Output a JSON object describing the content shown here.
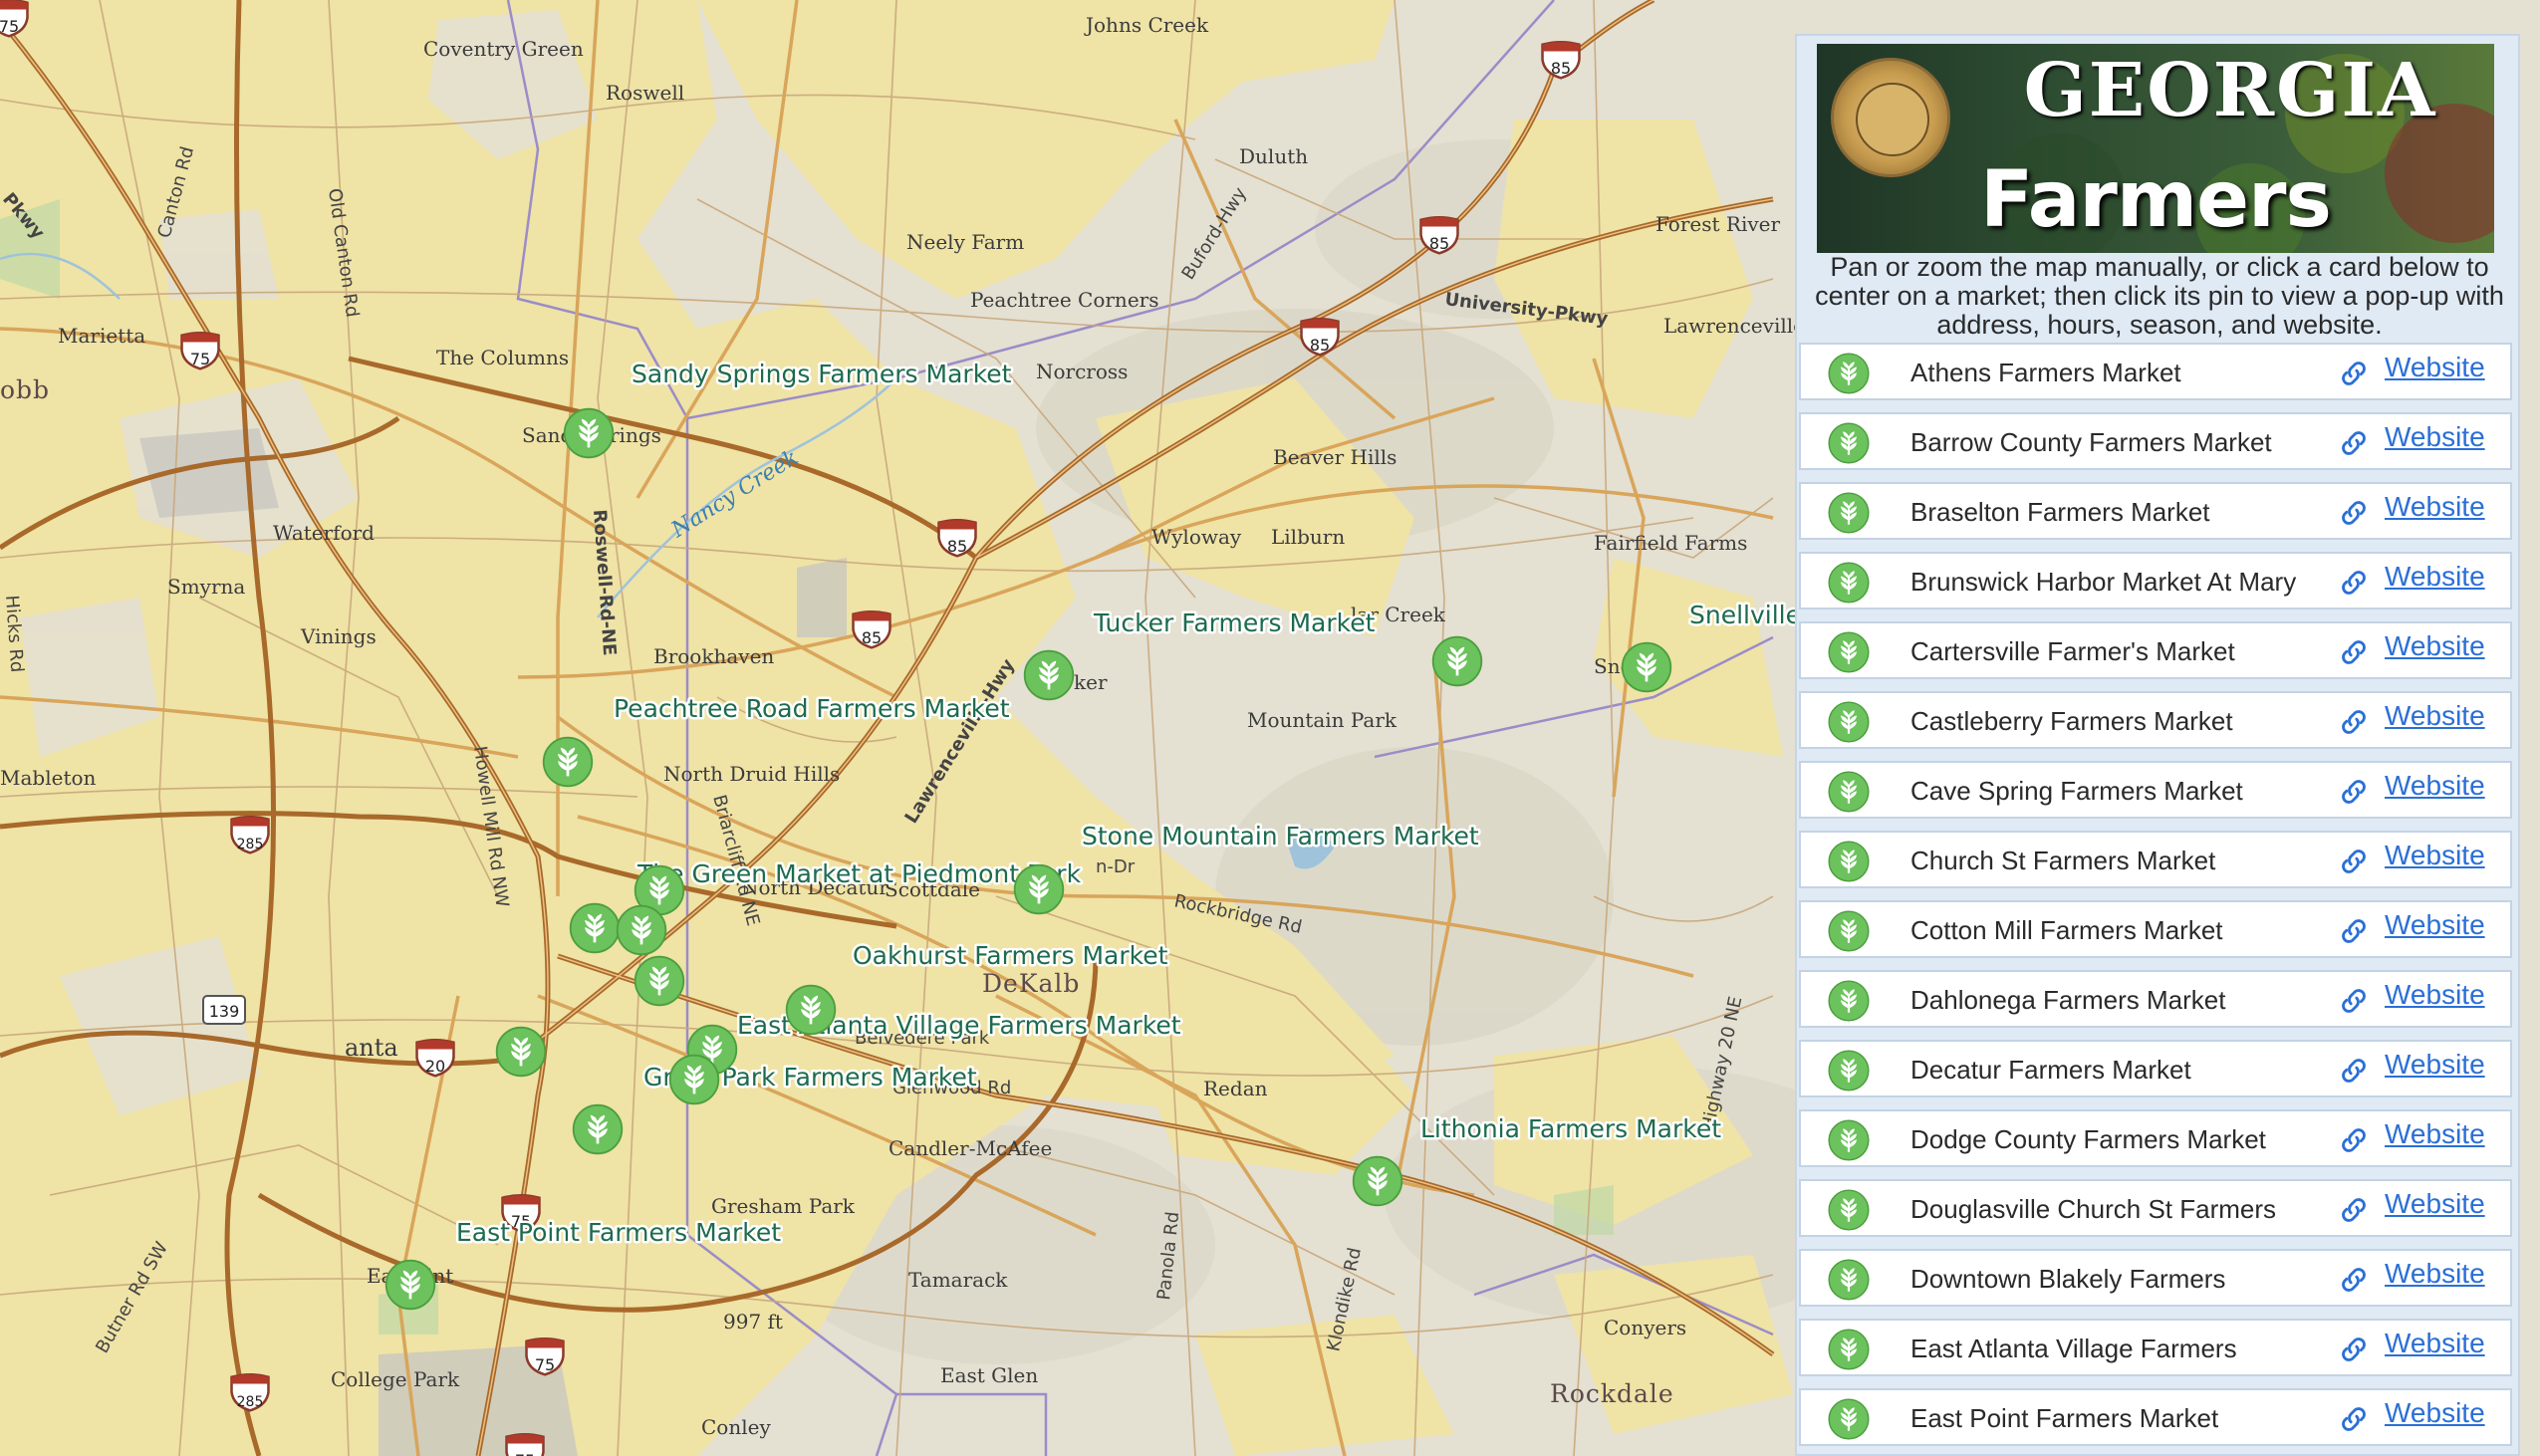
{
  "map": {
    "water_color": "#9ec3db",
    "urban_color": "#efe3a6",
    "terrain_color": "#e4e0d2",
    "highway_color": "#b07a3a",
    "pin_color": "#6cc25c",
    "place_labels": [
      {
        "id": "coventry-green",
        "text": "Coventry Green"
      },
      {
        "id": "johns-creek",
        "text": "Johns Creek"
      },
      {
        "id": "roswell",
        "text": "Roswell"
      },
      {
        "id": "duluth",
        "text": "Duluth"
      },
      {
        "id": "marietta",
        "text": "Marietta"
      },
      {
        "id": "neely-farm",
        "text": "Neely Farm"
      },
      {
        "id": "peachtree-corners",
        "text": "Peachtree Corners"
      },
      {
        "id": "the-columns",
        "text": "The Columns"
      },
      {
        "id": "norcross",
        "text": "Norcross"
      },
      {
        "id": "forest-river",
        "text": "Forest River"
      },
      {
        "id": "lawrenceville",
        "text": "Lawrenceville"
      },
      {
        "id": "beaver-hills",
        "text": "Beaver Hills"
      },
      {
        "id": "waterford",
        "text": "Waterford"
      },
      {
        "id": "wyloway",
        "text": "Wyloway"
      },
      {
        "id": "lilburn",
        "text": "Lilburn"
      },
      {
        "id": "fairfield-farms",
        "text": "Fairfield Farms"
      },
      {
        "id": "smyrna",
        "text": "Smyrna"
      },
      {
        "id": "vinings",
        "text": "Vinings"
      },
      {
        "id": "brookhaven",
        "text": "Brookhaven"
      },
      {
        "id": "mountain-park",
        "text": "Mountain Park"
      },
      {
        "id": "north-druid-hills",
        "text": "North Druid Hills"
      },
      {
        "id": "mableton",
        "text": "Mableton"
      },
      {
        "id": "scottdale",
        "text": "Scottdale"
      },
      {
        "id": "north-decatur",
        "text": "North Decatur"
      },
      {
        "id": "redan",
        "text": "Redan"
      },
      {
        "id": "candler-mcafee",
        "text": "Candler-McAfee"
      },
      {
        "id": "gresham-park",
        "text": "Gresham Park"
      },
      {
        "id": "tamarack",
        "text": "Tamarack"
      },
      {
        "id": "east-glen",
        "text": "East Glen"
      },
      {
        "id": "conyers",
        "text": "Conyers"
      },
      {
        "id": "college-park",
        "text": "College Park"
      },
      {
        "id": "conley",
        "text": "Conley"
      },
      {
        "id": "elevation",
        "text": "997 ft"
      }
    ],
    "county_labels": [
      {
        "id": "cobb",
        "text": "obb"
      },
      {
        "id": "dekalb",
        "text": "DeKalb"
      },
      {
        "id": "rockdale",
        "text": "Rockdale"
      }
    ],
    "road_labels": [
      {
        "id": "canton-rd",
        "text": "Canton Rd"
      },
      {
        "id": "old-canton-rd",
        "text": "Old Canton Rd"
      },
      {
        "id": "buford-hwy",
        "text": "Buford-Hwy"
      },
      {
        "id": "university-pkwy",
        "text": "University-Pkwy"
      },
      {
        "id": "roswell-rd",
        "text": "Roswell-Rd-NE"
      },
      {
        "id": "hicks-rd",
        "text": "Hicks Rd"
      },
      {
        "id": "howell-mill",
        "text": "Howell Mill Rd NW"
      },
      {
        "id": "briarcliff",
        "text": "Briarcliff Rd NE"
      },
      {
        "id": "lawrenceville-hwy",
        "text": "Lawrenceville-Hwy"
      },
      {
        "id": "rockbridge",
        "text": "Rockbridge Rd"
      },
      {
        "id": "panola",
        "text": "Panola Rd"
      },
      {
        "id": "klondike",
        "text": "Klondike Rd"
      },
      {
        "id": "highway-20",
        "text": "Highway 20 NE"
      },
      {
        "id": "butner",
        "text": "Butner Rd SW"
      },
      {
        "id": "pkwy",
        "text": "Pkwy"
      },
      {
        "id": "snapfinger",
        "text": "Glenwood Rd"
      },
      {
        "id": "belvedere",
        "text": "Belvedere Park"
      },
      {
        "id": "north-decatur-dr",
        "text": "n-Dr"
      }
    ],
    "water_labels": [
      {
        "id": "nancy-creek",
        "text": "Nancy Creek"
      }
    ],
    "shields": [
      {
        "id": "i75-north",
        "text": "75"
      },
      {
        "id": "i85-top",
        "text": "85"
      },
      {
        "id": "i85-mid",
        "text": "85"
      },
      {
        "id": "i85-east",
        "text": "85"
      },
      {
        "id": "i85-center",
        "text": "85"
      },
      {
        "id": "i85-south",
        "text": "85"
      },
      {
        "id": "i285-west",
        "text": "285"
      },
      {
        "id": "i285-south",
        "text": "285"
      },
      {
        "id": "i20",
        "text": "20"
      },
      {
        "id": "i75-south",
        "text": "75"
      },
      {
        "id": "i75-south2",
        "text": "75"
      },
      {
        "id": "i75-bottom",
        "text": "75"
      },
      {
        "id": "us139",
        "text": "139"
      },
      {
        "id": "i75-corner",
        "text": "75"
      }
    ],
    "atlanta_label": "Atlanta",
    "atlanta_prefix": "anta",
    "sandy_label": "Sand",
    "sandy_suffix": "rings",
    "tucker_suffix": "ker",
    "snell_prefix": "Sne",
    "eastpoint_prefix": "Ea",
    "eastpoint_suffix": "int",
    "parker_creek": "lar Creek",
    "market_labels": [
      {
        "id": "sandy-springs",
        "text": "Sandy Springs Farmers Market"
      },
      {
        "id": "tucker",
        "text": "Tucker Farmers Market"
      },
      {
        "id": "snellville",
        "text": "Snellville"
      },
      {
        "id": "peachtree-road",
        "text": "Peachtree Road Farmers Market"
      },
      {
        "id": "stone-mountain",
        "text": "Stone Mountain Farmers Market"
      },
      {
        "id": "green-market",
        "text": "The Green Market at Piedmont Park"
      },
      {
        "id": "oakhurst",
        "text": "Oakhurst Farmers Market"
      },
      {
        "id": "east-atlanta",
        "text": "East Atlanta Village Farmers Market"
      },
      {
        "id": "grant-park",
        "text": "Grant Park Farmers Market"
      },
      {
        "id": "lithonia",
        "text": "Lithonia Farmers Market"
      },
      {
        "id": "east-point",
        "text": "East Point Farmers Market"
      }
    ]
  },
  "panel": {
    "banner_title": "GEORGIA",
    "banner_subtitle": "Farmers Markets",
    "instructions": "Pan or zoom the map manually, or click a card below to center on a market; then click its pin to view a pop-up with address, hours, season, and website.",
    "link_label": "Website",
    "markets": [
      "Athens Farmers Market",
      "Barrow County Farmers Market",
      "Braselton Farmers Market",
      "Brunswick Harbor Market At Mary",
      "Cartersville Farmer's Market",
      "Castleberry Farmers Market",
      "Cave Spring Farmers Market",
      "Church St Farmers Market",
      "Cotton Mill Farmers Market",
      "Dahlonega Farmers Market",
      "Decatur Farmers Market",
      "Dodge County Farmers Market",
      "Douglasville Church St Farmers",
      "Downtown Blakely Farmers",
      "East Atlanta Village Farmers",
      "East Point Farmers Market"
    ]
  }
}
